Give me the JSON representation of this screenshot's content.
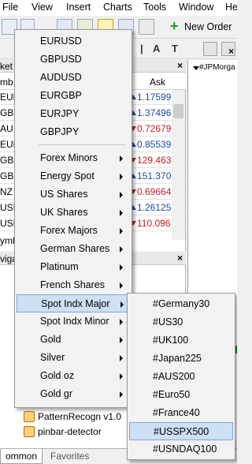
{
  "menubar": {
    "items": [
      "File",
      "View",
      "Insert",
      "Charts",
      "Tools",
      "Window",
      "He"
    ]
  },
  "toolbar": {
    "new_order_label": "New Order"
  },
  "toolbar2": {
    "font_a_label": "A",
    "text_t_label": "T"
  },
  "market_watch": {
    "title": "ket",
    "close": "×",
    "header_symbol": "mb",
    "header_ask": "Ask",
    "rows": [
      {
        "symbol": "EUR",
        "ask": "1.17599",
        "color": "#1a4aa8",
        "dir": "up"
      },
      {
        "symbol": "GBF",
        "ask": "1.37496",
        "color": "#1a4aa8",
        "dir": "up"
      },
      {
        "symbol": "AU",
        "ask": "0.72679",
        "color": "#c02020",
        "dir": "down"
      },
      {
        "symbol": "EUR",
        "ask": "0.85539",
        "color": "#1a4aa8",
        "dir": "up"
      },
      {
        "symbol": "GBF",
        "ask": "129.463",
        "color": "#c02020",
        "dir": "down"
      },
      {
        "symbol": "GBF",
        "ask": "151.370",
        "color": "#1a4aa8",
        "dir": "up"
      },
      {
        "symbol": "NZ",
        "ask": "0.69664",
        "color": "#c02020",
        "dir": "down"
      },
      {
        "symbol": "USD",
        "ask": "1.26125",
        "color": "#1a4aa8",
        "dir": "up"
      },
      {
        "symbol": "USD",
        "ask": "110.096",
        "color": "#c02020",
        "dir": "down"
      }
    ],
    "footer": "ymb"
  },
  "chart": {
    "title": "#JPMorga",
    "close": "×"
  },
  "navigator": {
    "title": "vigat",
    "close": "×",
    "items": [
      "PatternRecogn v1.0",
      "pinbar-detector"
    ]
  },
  "tabs": [
    "ommon",
    "Favorites"
  ],
  "menu_main": {
    "pairs": [
      "EURUSD",
      "GBPUSD",
      "AUDUSD",
      "EURGBP",
      "EURJPY",
      "GBPJPY"
    ],
    "groups": [
      "Forex Minors",
      "Energy Spot",
      "US Shares",
      "UK Shares",
      "Forex Majors",
      "German Shares",
      "Platinum",
      "French Shares",
      "Spot Indx Major",
      "Spot Indx Minor",
      "Gold",
      "Silver",
      "Gold oz",
      "Gold gr"
    ],
    "highlighted": "Spot Indx Major"
  },
  "menu_sub": {
    "items": [
      "#Germany30",
      "#US30",
      "#UK100",
      "#Japan225",
      "#AUS200",
      "#Euro50",
      "#France40",
      "#USSPX500",
      "#USNDAQ100"
    ],
    "highlighted": "#USSPX500"
  }
}
